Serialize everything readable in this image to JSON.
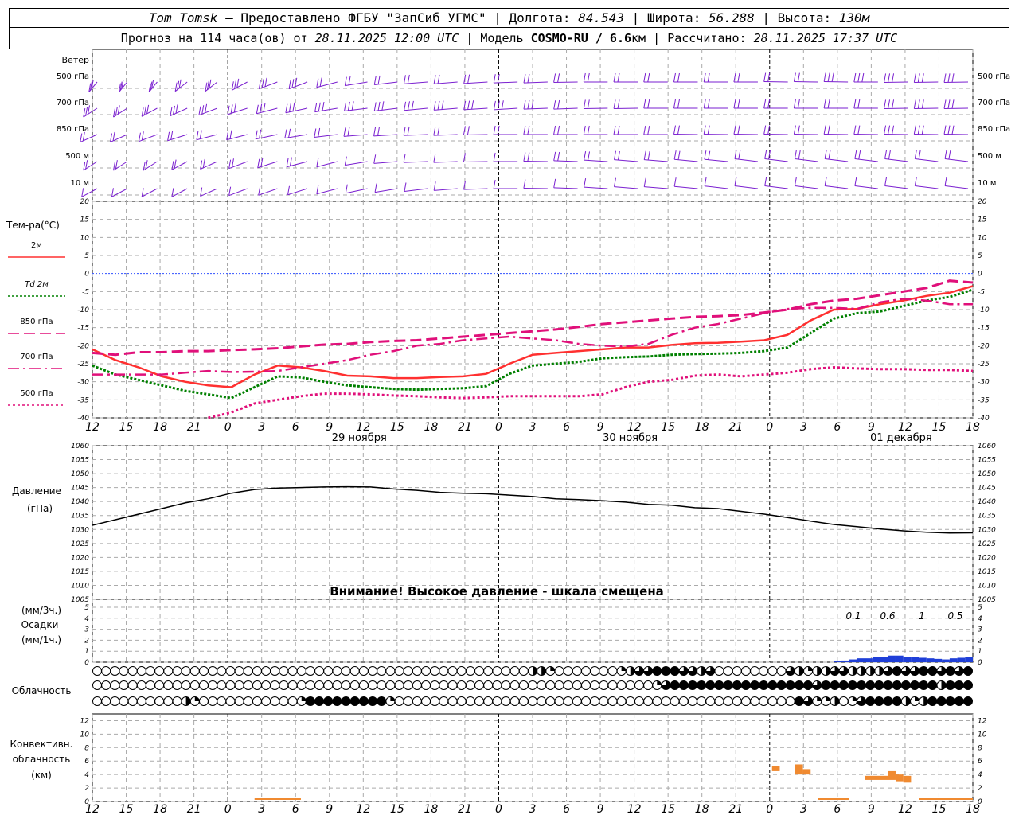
{
  "header": {
    "station": "Tom_Tomsk",
    "provider": "– Предоставлено ФГБУ \"ЗапСиб УГМС\"",
    "lon_label": "Долгота:",
    "lon": "84.543",
    "lat_label": "Широта:",
    "lat": "56.288",
    "alt_label": "Высота:",
    "alt": "130м",
    "forecast_prefix": "Прогноз на 114 часа(ов) от",
    "forecast_start": "28.11.2025 12:00 UTC",
    "model_label": "Модель",
    "model": "COSMO-RU / 6.6",
    "model_unit": "км",
    "calc_label": "Рассчитано:",
    "calc_time": "28.11.2025 17:37 UTC"
  },
  "colors": {
    "wind": "#7a1fd0",
    "t2m": "#ff3030",
    "td2m": "#008000",
    "t850": "#e0107a",
    "t700": "#e0107a",
    "t500": "#e0107a",
    "zero_line": "#3050ff",
    "pressure": "#000000",
    "precip": "#1f3fd8",
    "convective": "#f08a30"
  },
  "time_axis": {
    "hour_ticks": [
      "12",
      "15",
      "18",
      "21",
      "0",
      "3",
      "6",
      "9",
      "12",
      "15",
      "18",
      "21",
      "0",
      "3",
      "6",
      "9",
      "12",
      "15",
      "18",
      "21",
      "0",
      "3",
      "6",
      "9",
      "12",
      "15",
      "18"
    ],
    "day_labels": [
      "29 ноября",
      "30 ноября",
      "01 декабря"
    ]
  },
  "chart_data": [
    {
      "type": "wind-barbs",
      "title": "Ветер",
      "levels": [
        "500 гПа",
        "700 гПа",
        "850 гПа",
        "500 м",
        "10  м"
      ]
    },
    {
      "type": "line",
      "ylabel": "Тем-ра(°C)",
      "ylim": [
        -40,
        20
      ],
      "yticks": [
        "20",
        "15",
        "10",
        "5",
        "0",
        "-5",
        "-10",
        "-15",
        "-20",
        "-25",
        "-30",
        "-35",
        "-40"
      ],
      "series": [
        {
          "name": "2м",
          "style": "solid",
          "x_hours": [
            0,
            3,
            6,
            9,
            12,
            15,
            18,
            21,
            24,
            27,
            30,
            33,
            36,
            39,
            42,
            45,
            48,
            51,
            54,
            57,
            60,
            63,
            66,
            69,
            72,
            75,
            78,
            81,
            84,
            87,
            90,
            93,
            96,
            99,
            102,
            105,
            108,
            111,
            114
          ],
          "values": [
            -21,
            -24,
            -26,
            -28.5,
            -30,
            -31,
            -31.5,
            -28,
            -25.5,
            -26,
            -27,
            -28.3,
            -28.5,
            -29,
            -29,
            -28.7,
            -28.5,
            -27.8,
            -25,
            -22.5,
            -22,
            -21.5,
            -21,
            -20.5,
            -20.5,
            -19.8,
            -19.3,
            -19.2,
            -18.9,
            -18.5,
            -17,
            -13,
            -10,
            -9.8,
            -8.5,
            -7.5,
            -6.2,
            -5.3,
            -3.5
          ]
        },
        {
          "name": "Td 2м",
          "style": "dotted",
          "x_hours": [
            0,
            3,
            6,
            9,
            12,
            15,
            18,
            21,
            24,
            27,
            30,
            33,
            36,
            39,
            42,
            45,
            48,
            51,
            54,
            57,
            60,
            63,
            66,
            69,
            72,
            75,
            78,
            81,
            84,
            87,
            90,
            93,
            96,
            99,
            102,
            105,
            108,
            111,
            114
          ],
          "values": [
            -25.5,
            -28,
            -29.5,
            -31,
            -32.5,
            -33.5,
            -34.5,
            -31.5,
            -28.5,
            -28.8,
            -30,
            -31,
            -31.5,
            -32,
            -32.2,
            -32,
            -31.8,
            -31.2,
            -27.8,
            -25.5,
            -25,
            -24.5,
            -23.5,
            -23.2,
            -23,
            -22.5,
            -22.3,
            -22.2,
            -22,
            -21.5,
            -20.5,
            -16.5,
            -12.5,
            -11,
            -10.5,
            -9,
            -7.5,
            -6.5,
            -4.5
          ]
        },
        {
          "name": "850 гПа",
          "style": "long-dash",
          "x_hours": [
            0,
            3,
            6,
            9,
            12,
            15,
            18,
            21,
            24,
            27,
            30,
            33,
            36,
            39,
            42,
            45,
            48,
            51,
            54,
            57,
            60,
            63,
            66,
            69,
            72,
            75,
            78,
            81,
            84,
            87,
            90,
            93,
            96,
            99,
            102,
            105,
            108,
            111,
            114
          ],
          "values": [
            -22,
            -22.5,
            -21.8,
            -21.8,
            -21.5,
            -21.5,
            -21.2,
            -21,
            -20.7,
            -20.2,
            -19.7,
            -19.5,
            -19,
            -18.7,
            -18.5,
            -18,
            -17.5,
            -17,
            -16.5,
            -16,
            -15.5,
            -14.8,
            -14,
            -13.5,
            -13,
            -12.5,
            -12,
            -11.8,
            -11.5,
            -10.8,
            -10,
            -8.5,
            -7.5,
            -7,
            -6,
            -5,
            -4,
            -2,
            -2.5
          ]
        },
        {
          "name": "700 гПа",
          "style": "dash-dot",
          "x_hours": [
            0,
            3,
            6,
            9,
            12,
            15,
            18,
            21,
            24,
            27,
            30,
            33,
            36,
            39,
            42,
            45,
            48,
            51,
            54,
            57,
            60,
            63,
            66,
            69,
            72,
            75,
            78,
            81,
            84,
            87,
            90,
            93,
            96,
            99,
            102,
            105,
            108,
            111,
            114
          ],
          "values": [
            -28,
            -28,
            -28,
            -28,
            -27.5,
            -27,
            -27.3,
            -27.2,
            -27,
            -26,
            -25,
            -24,
            -22.5,
            -21.5,
            -20,
            -19.5,
            -18.5,
            -18,
            -17.5,
            -18,
            -18.5,
            -19.5,
            -20,
            -20.2,
            -19.5,
            -17,
            -15,
            -14,
            -12.5,
            -11,
            -9.8,
            -9.5,
            -9.5,
            -9.8,
            -8,
            -7,
            -7.5,
            -8.5,
            -8.5
          ]
        },
        {
          "name": "500 гПа",
          "style": "short-dash",
          "x_hours": [
            15,
            18,
            21,
            24,
            27,
            30,
            33,
            36,
            39,
            42,
            45,
            48,
            51,
            54,
            57,
            60,
            63,
            66,
            69,
            72,
            75,
            78,
            81,
            84,
            87,
            90,
            93,
            96,
            99,
            102,
            105,
            108,
            111,
            114
          ],
          "values": [
            -40,
            -38.5,
            -36,
            -35,
            -34,
            -33.3,
            -33.3,
            -33.5,
            -33.8,
            -34,
            -34.3,
            -34.5,
            -34.3,
            -34,
            -34,
            -34,
            -34,
            -33.5,
            -31.5,
            -30,
            -29.5,
            -28.3,
            -28,
            -28.5,
            -28,
            -27.5,
            -26.5,
            -26,
            -26.3,
            -26.5,
            -26.5,
            -26.7,
            -26.7,
            -27
          ]
        }
      ]
    },
    {
      "type": "line",
      "ylabel": "Давление",
      "yunit": "(гПа)",
      "ylim": [
        1005,
        1060
      ],
      "yticks": [
        "1060",
        "1055",
        "1050",
        "1045",
        "1040",
        "1035",
        "1030",
        "1025",
        "1020",
        "1015",
        "1010",
        "1005"
      ],
      "annotation": "Внимание! Высокое давление - шкала смещена",
      "series": [
        {
          "name": "",
          "x_hours": [
            0,
            3,
            6,
            9,
            12,
            15,
            18,
            21,
            24,
            27,
            30,
            33,
            36,
            39,
            42,
            45,
            48,
            51,
            54,
            57,
            60,
            63,
            66,
            69,
            72,
            75,
            78,
            81,
            84,
            87,
            90,
            93,
            96,
            99,
            102,
            105,
            108,
            111,
            114
          ],
          "values": [
            1031.5,
            1033.5,
            1035.5,
            1037.5,
            1039.5,
            1041,
            1043,
            1044.3,
            1044.8,
            1045,
            1045.2,
            1045.3,
            1045.2,
            1044.5,
            1044,
            1043.3,
            1043,
            1042.8,
            1042.3,
            1041.8,
            1041,
            1040.7,
            1040.3,
            1039.8,
            1039,
            1038.7,
            1037.8,
            1037.5,
            1036.5,
            1035.5,
            1034.3,
            1033,
            1031.8,
            1031,
            1030.2,
            1029.5,
            1029,
            1028.7,
            1028.8
          ]
        }
      ]
    },
    {
      "type": "bar",
      "ylabel_top": "(мм/3ч.)",
      "ylabel": "Осадки",
      "ylabel_bottom": "(мм/1ч.)",
      "ylim": [
        0,
        5
      ],
      "yticks": [
        "5",
        "4",
        "3",
        "2",
        "1",
        "0"
      ],
      "interval_totals": [
        "0.1",
        "0.6",
        "1",
        "0.5"
      ],
      "x_hours": [
        97,
        98,
        99,
        100,
        101,
        102,
        103,
        104,
        105,
        106,
        107,
        108,
        109,
        110,
        111,
        112,
        113,
        114
      ],
      "values": [
        0.1,
        0.15,
        0.25,
        0.35,
        0.35,
        0.45,
        0.45,
        0.6,
        0.6,
        0.5,
        0.5,
        0.4,
        0.35,
        0.3,
        0.25,
        0.35,
        0.4,
        0.45
      ]
    },
    {
      "type": "table",
      "ylabel": "Облачность",
      "rows": 3,
      "steps": 99,
      "fraction_cover_by_row": "Rows of cloud-cover symbols (0=clear,1=overcast) per hour step, top=high, middle=mid, bottom=low",
      "high": [
        0,
        0,
        0,
        0,
        0,
        0,
        0,
        0,
        0,
        0,
        0,
        0,
        0,
        0,
        0,
        0,
        0,
        0,
        0,
        0,
        0,
        0,
        0,
        0,
        0,
        0,
        0,
        0,
        0,
        0,
        0,
        0,
        0,
        0,
        0,
        0,
        0,
        0,
        0,
        0,
        0,
        0,
        0,
        0,
        0,
        0,
        0,
        0,
        0,
        0.5,
        0.5,
        0.25,
        0,
        0,
        0,
        0,
        0,
        0,
        0,
        0.25,
        0.5,
        0.75,
        0.75,
        1,
        1,
        1,
        0.75,
        0.75,
        0.5,
        0.75,
        0,
        0,
        0,
        0,
        0,
        0,
        0,
        0,
        0.75,
        0.5,
        0.25,
        0.5,
        0.5,
        0.75,
        0.75,
        0.5,
        0.5,
        0.5,
        0.5,
        0.75,
        1,
        0.75,
        0.75,
        1,
        1,
        0.75,
        1,
        0.75,
        1
      ],
      "mid": [
        0,
        0,
        0,
        0,
        0,
        0,
        0,
        0,
        0,
        0,
        0,
        0,
        0,
        0,
        0,
        0,
        0,
        0,
        0,
        0,
        0,
        0,
        0,
        0,
        0,
        0,
        0,
        0,
        0,
        0,
        0,
        0,
        0,
        0,
        0,
        0,
        0,
        0,
        0,
        0,
        0,
        0,
        0,
        0,
        0,
        0,
        0,
        0,
        0,
        0,
        0,
        0,
        0,
        0,
        0,
        0,
        0,
        0,
        0,
        0,
        0,
        0,
        0,
        0.25,
        0.75,
        1,
        1,
        1,
        1,
        1,
        1,
        1,
        1,
        1,
        1,
        1,
        1,
        1,
        1,
        1,
        1,
        0.75,
        1,
        1,
        1,
        1,
        1,
        1,
        1,
        1,
        1,
        1,
        1,
        1,
        1,
        0.5,
        1,
        1,
        1
      ],
      "low": [
        0,
        0,
        0,
        0,
        0,
        0,
        0,
        0,
        0,
        0,
        0.5,
        0.25,
        0,
        0,
        0,
        0,
        0,
        0,
        0,
        0,
        0,
        0,
        0,
        0.25,
        1,
        1,
        1,
        1,
        1,
        1,
        1,
        1,
        1,
        0.25,
        0,
        0,
        0,
        0,
        0,
        0,
        0,
        0,
        0,
        0,
        0,
        0,
        0,
        0,
        0,
        0,
        0,
        0,
        0,
        0,
        0,
        0,
        0,
        0,
        0,
        0,
        0,
        0,
        0,
        0,
        0,
        0,
        0,
        0,
        0,
        0,
        0,
        0,
        0,
        0,
        0,
        0,
        0,
        0,
        0,
        1,
        0.75,
        0.25,
        0.25,
        0.5,
        0,
        0.25,
        0.75,
        1,
        1,
        1,
        1,
        0.5,
        0.25,
        0.5,
        1,
        1,
        1,
        1,
        1,
        1
      ]
    },
    {
      "type": "bar",
      "ylabel": "Конвективн. облачность",
      "yunit": "(км)",
      "ylim": [
        0,
        13
      ],
      "yticks": [
        "12",
        "10",
        "8",
        "6",
        "4",
        "2",
        "0"
      ],
      "cloud_layers_km": [
        {
          "from_hour": 88,
          "to_hour": 89,
          "base": 4.5,
          "top": 5.2
        },
        {
          "from_hour": 91,
          "to_hour": 92,
          "base": 4,
          "top": 5.5
        },
        {
          "from_hour": 92,
          "to_hour": 93,
          "base": 4,
          "top": 4.8
        },
        {
          "from_hour": 100,
          "to_hour": 103,
          "base": 3.2,
          "top": 3.8
        },
        {
          "from_hour": 103,
          "to_hour": 104,
          "base": 3.2,
          "top": 4.5
        },
        {
          "from_hour": 104,
          "to_hour": 105,
          "base": 3,
          "top": 4
        },
        {
          "from_hour": 105,
          "to_hour": 106,
          "base": 2.8,
          "top": 3.8
        }
      ],
      "ground_lines_hours": [
        [
          21,
          27
        ],
        [
          94,
          98
        ],
        [
          107,
          114
        ]
      ]
    }
  ]
}
